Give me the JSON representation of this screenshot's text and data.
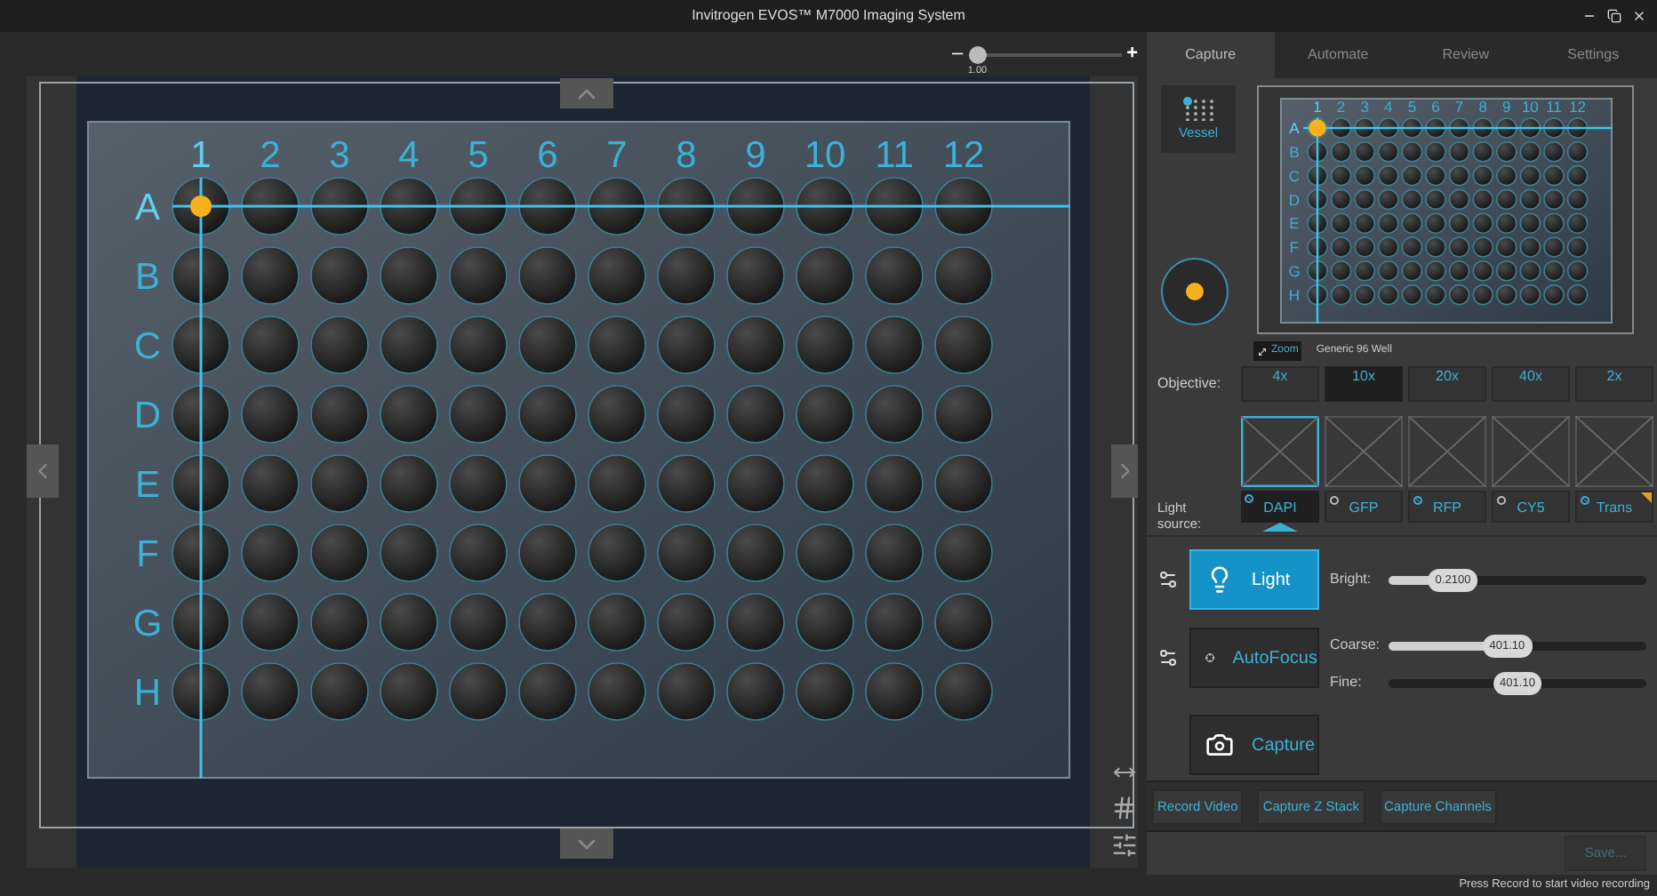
{
  "window": {
    "title": "Invitrogen EVOS™ M7000 Imaging System"
  },
  "zoom": {
    "minus": "–",
    "plus": "+",
    "value": "1.00",
    "level": 0.06
  },
  "plate": {
    "columns": [
      {
        "label": "1",
        "selected": true
      },
      {
        "label": "2",
        "selected": false
      },
      {
        "label": "3",
        "selected": false
      },
      {
        "label": "4",
        "selected": false
      },
      {
        "label": "5",
        "selected": false
      },
      {
        "label": "6",
        "selected": false
      },
      {
        "label": "7",
        "selected": false
      },
      {
        "label": "8",
        "selected": false
      },
      {
        "label": "9",
        "selected": false
      },
      {
        "label": "10",
        "selected": false
      },
      {
        "label": "11",
        "selected": false
      },
      {
        "label": "12",
        "selected": false
      }
    ],
    "rows": [
      {
        "label": "A",
        "selected": true
      },
      {
        "label": "B",
        "selected": false
      },
      {
        "label": "C",
        "selected": false
      },
      {
        "label": "D",
        "selected": false
      },
      {
        "label": "E",
        "selected": false
      },
      {
        "label": "F",
        "selected": false
      },
      {
        "label": "G",
        "selected": false
      },
      {
        "label": "H",
        "selected": false
      }
    ]
  },
  "tabs": [
    {
      "label": "Capture",
      "selected": true
    },
    {
      "label": "Automate",
      "selected": false
    },
    {
      "label": "Review",
      "selected": false
    },
    {
      "label": "Settings",
      "selected": false
    }
  ],
  "vessel_button": {
    "label": "Vessel"
  },
  "minimap": {
    "columns": [
      {
        "label": "1",
        "selected": true
      },
      {
        "label": "2",
        "selected": false
      },
      {
        "label": "3",
        "selected": false
      },
      {
        "label": "4",
        "selected": false
      },
      {
        "label": "5",
        "selected": false
      },
      {
        "label": "6",
        "selected": false
      },
      {
        "label": "7",
        "selected": false
      },
      {
        "label": "8",
        "selected": false
      },
      {
        "label": "9",
        "selected": false
      },
      {
        "label": "10",
        "selected": false
      },
      {
        "label": "11",
        "selected": false
      },
      {
        "label": "12",
        "selected": false
      }
    ],
    "rows": [
      {
        "label": "A",
        "selected": true
      },
      {
        "label": "B",
        "selected": false
      },
      {
        "label": "C",
        "selected": false
      },
      {
        "label": "D",
        "selected": false
      },
      {
        "label": "E",
        "selected": false
      },
      {
        "label": "F",
        "selected": false
      },
      {
        "label": "G",
        "selected": false
      },
      {
        "label": "H",
        "selected": false
      }
    ]
  },
  "zoom_button": {
    "label": "Zoom"
  },
  "vessel_name": "Generic 96 Well",
  "objective": {
    "label": "Objective:",
    "options": [
      {
        "label": "4x",
        "selected": false
      },
      {
        "label": "10x",
        "selected": true
      },
      {
        "label": "20x",
        "selected": false
      },
      {
        "label": "40x",
        "selected": false
      },
      {
        "label": "2x",
        "selected": false
      }
    ]
  },
  "light_source": {
    "label": "Light source:",
    "channels": [
      {
        "label": "DAPI",
        "selected": true,
        "enabled": true,
        "flagged": false
      },
      {
        "label": "GFP",
        "selected": false,
        "enabled": false,
        "flagged": false
      },
      {
        "label": "RFP",
        "selected": false,
        "enabled": true,
        "flagged": false
      },
      {
        "label": "CY5",
        "selected": false,
        "enabled": false,
        "flagged": false
      },
      {
        "label": "Trans",
        "selected": false,
        "enabled": true,
        "flagged": true
      }
    ]
  },
  "light": {
    "label": "Light",
    "on": true,
    "bright": {
      "label": "Bright:",
      "value": "0.2100",
      "level": 0.25
    }
  },
  "autofocus": {
    "label": "AutoFocus",
    "on": false,
    "coarse": {
      "label": "Coarse:",
      "value": "401.10",
      "level": 0.46
    },
    "fine": {
      "label": "Fine:",
      "value": "401.10",
      "level": 0.5
    }
  },
  "capture": {
    "label": "Capture",
    "on": false
  },
  "actions": [
    {
      "label": "Record Video"
    },
    {
      "label": "Capture Z Stack"
    },
    {
      "label": "Capture Channels"
    }
  ],
  "save": {
    "label": "Save...",
    "disabled": true
  },
  "status": "Press Record to start video recording"
}
